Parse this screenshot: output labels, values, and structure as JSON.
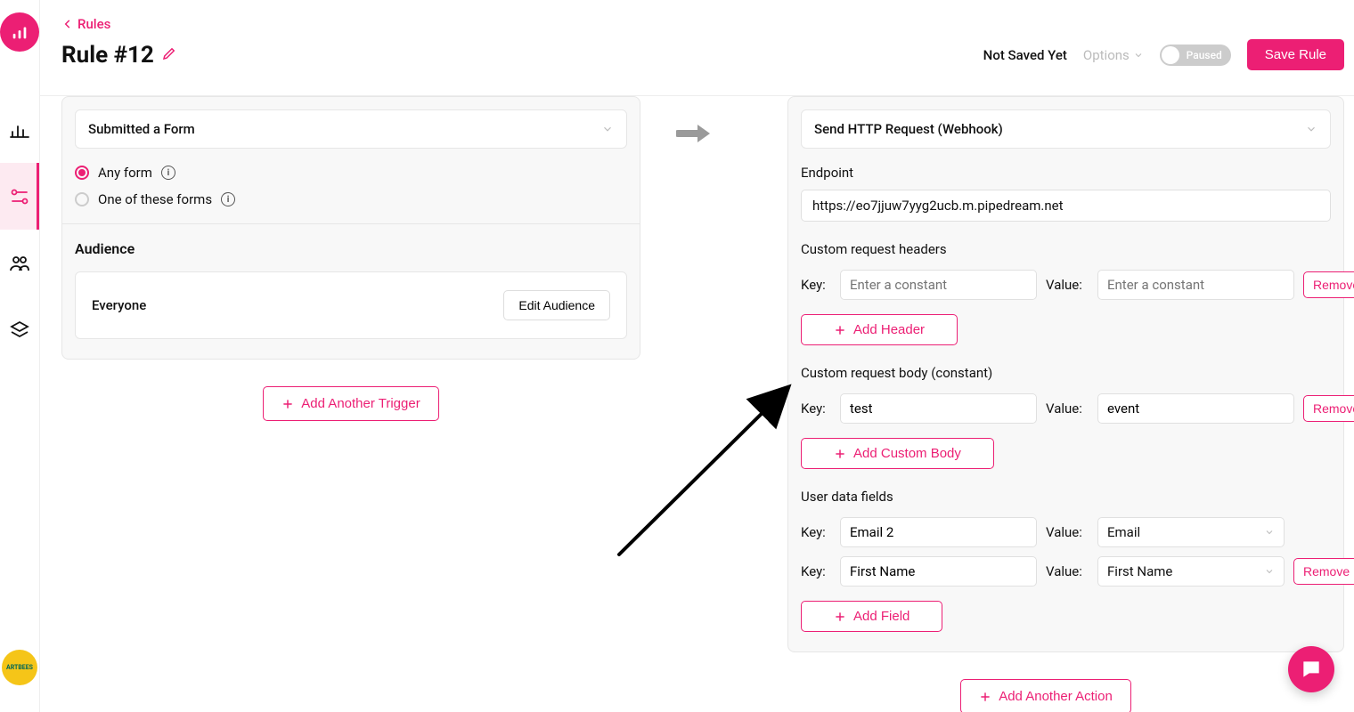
{
  "breadcrumb": {
    "label": "Rules"
  },
  "header": {
    "title": "Rule #12",
    "status": "Not Saved Yet",
    "options_label": "Options",
    "toggle_label": "Paused",
    "save_label": "Save Rule"
  },
  "trigger": {
    "select_label": "Submitted a Form",
    "radio_any": "Any form",
    "radio_specific": "One of these forms",
    "audience_title": "Audience",
    "audience_value": "Everyone",
    "edit_audience_label": "Edit Audience",
    "add_trigger_label": "Add Another Trigger"
  },
  "action": {
    "select_label": "Send HTTP Request (Webhook)",
    "endpoint_label": "Endpoint",
    "endpoint_value": "https://eo7jjuw7yyg2ucb.m.pipedream.net",
    "headers_title": "Custom request headers",
    "key_label": "Key:",
    "value_label": "Value:",
    "header_key_placeholder": "Enter a constant",
    "header_value_placeholder": "Enter a constant",
    "remove_label": "Remove",
    "add_header_label": "Add Header",
    "body_title": "Custom request body (constant)",
    "body_key_value": "test",
    "body_value_value": "event",
    "add_body_label": "Add Custom Body",
    "userdata_title": "User data fields",
    "userdata": [
      {
        "key": "Email 2",
        "value": "Email"
      },
      {
        "key": "First Name",
        "value": "First Name"
      }
    ],
    "add_field_label": "Add Field",
    "add_action_label": "Add Another Action"
  },
  "avatar": {
    "label": "ARTBEES"
  }
}
